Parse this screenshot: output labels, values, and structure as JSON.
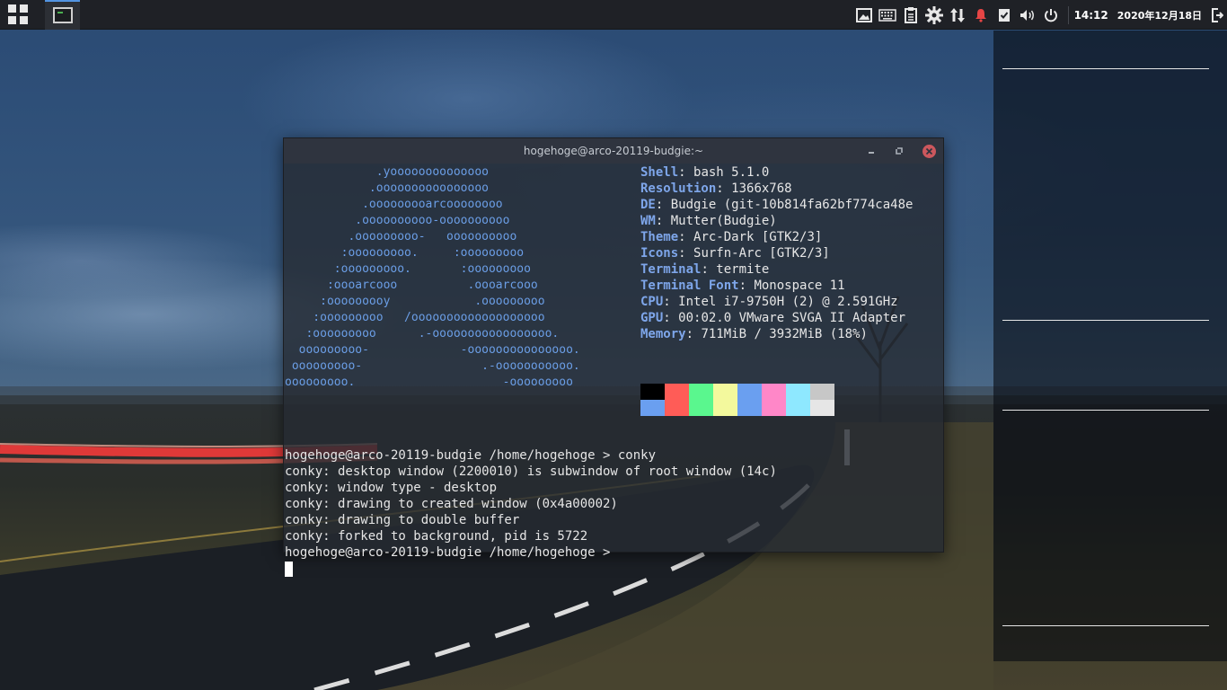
{
  "panel": {
    "apps_icon": "app-grid-icon",
    "task_icon": "terminal-icon",
    "tray_icons": [
      "image-viewer-icon",
      "keyboard-icon",
      "clipboard-icon",
      "gear-icon",
      "network-arrows-icon",
      "bell-icon",
      "checkbox-icon",
      "volume-icon",
      "power-icon"
    ],
    "clock": "14:12",
    "date": "2020年12月18日",
    "exit_icon": "logout-icon",
    "accent_color": "#5294e2"
  },
  "terminal": {
    "title": "hogehoge@arco-20119-budgie:~",
    "ascii_art": [
      "             .yoooooooooooooo",
      "            .oooooooooooooooo",
      "           .ooooooooarcoooooooo",
      "          .oooooooooo-oooooooooo",
      "         .ooooooooo-   oooooooooo",
      "        :ooooooooo.     :ooooooooo",
      "       :ooooooooo.       :ooooooooo",
      "      :oooarcooo          .oooarcooo",
      "     :ooooooooy            .ooooooooo",
      "    :ooooooooo   /ooooooooooooooooooo",
      "   :ooooooooo      .-ooooooooooooooooo.",
      "  ooooooooo-             -ooooooooooooooo.",
      " ooooooooo-                 .-ooooooooooo.",
      "ooooooooo.                     -ooooooooo"
    ],
    "info": [
      {
        "key": "Shell",
        "value": "bash 5.1.0"
      },
      {
        "key": "Resolution",
        "value": "1366x768"
      },
      {
        "key": "DE",
        "value": "Budgie (git-10b814fa62bf774ca48e"
      },
      {
        "key": "WM",
        "value": "Mutter(Budgie)"
      },
      {
        "key": "Theme",
        "value": "Arc-Dark [GTK2/3]"
      },
      {
        "key": "Icons",
        "value": "Surfn-Arc [GTK2/3]"
      },
      {
        "key": "Terminal",
        "value": "termite"
      },
      {
        "key": "Terminal Font",
        "value": "Monospace 11"
      },
      {
        "key": "CPU",
        "value": "Intel i7-9750H (2) @ 2.591GHz"
      },
      {
        "key": "GPU",
        "value": "00:02.0 VMware SVGA II Adapter"
      },
      {
        "key": "Memory",
        "value": "711MiB / 3932MiB (18%)"
      }
    ],
    "palette_top": [
      "#000000",
      "#ff5c57",
      "#5af78e",
      "#f3f99d",
      "#6a9ff0",
      "#ff87c8",
      "#8ee8ff",
      "#c7c7c7"
    ],
    "palette_bottom": [
      "#6a9ff0",
      "#ff5c57",
      "#5af78e",
      "#f3f99d",
      "#6a9ff0",
      "#ff87c8",
      "#8ee8ff",
      "#e6e6e6"
    ],
    "output_lines": [
      "hogehoge@arco-20119-budgie /home/hogehoge > conky",
      "conky: desktop window (2200010) is subwindow of root window (14c)",
      "conky: window type - desktop",
      "conky: drawing to created window (0x4a00002)",
      "conky: drawing to double buffer",
      "conky: forked to background, pid is 5722",
      "hogehoge@arco-20119-budgie /home/hogehoge >"
    ]
  }
}
